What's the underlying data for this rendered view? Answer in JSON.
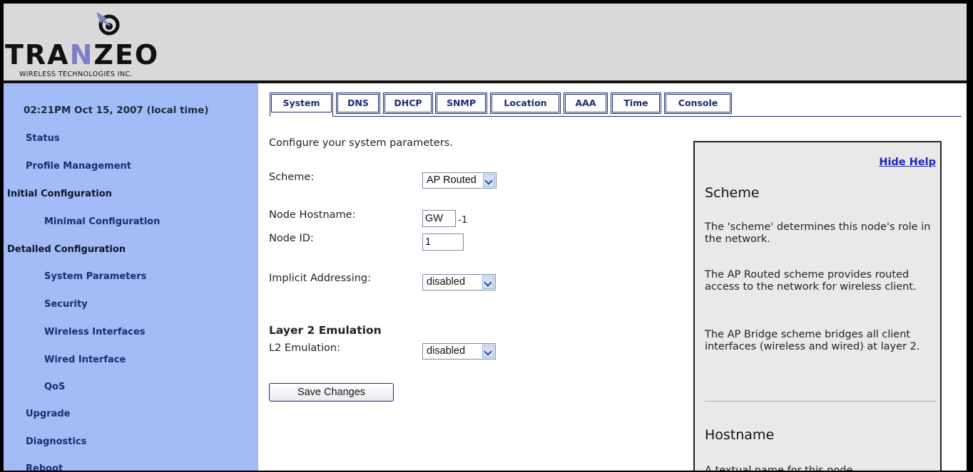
{
  "brand": {
    "name_parts": [
      "TRA",
      "N",
      "ZEO"
    ],
    "tagline": "WIRELESS TECHNOLOGIES INC.",
    "accent_color": "#7a7fc8"
  },
  "sidebar": {
    "clock": "02:21PM Oct 15, 2007 (local time)",
    "items": [
      {
        "label": "Status"
      },
      {
        "label": "Profile Management"
      },
      {
        "label": "Initial Configuration"
      },
      {
        "label": "Minimal Configuration"
      },
      {
        "label": "Detailed Configuration"
      },
      {
        "label": "System Parameters"
      },
      {
        "label": "Security"
      },
      {
        "label": "Wireless Interfaces"
      },
      {
        "label": "Wired Interface"
      },
      {
        "label": "QoS"
      },
      {
        "label": "Upgrade"
      },
      {
        "label": "Diagnostics"
      },
      {
        "label": "Reboot"
      }
    ]
  },
  "tabs": [
    {
      "label": "System",
      "active": true
    },
    {
      "label": "DNS"
    },
    {
      "label": "DHCP"
    },
    {
      "label": "SNMP"
    },
    {
      "label": "Location"
    },
    {
      "label": "AAA"
    },
    {
      "label": "Time"
    },
    {
      "label": "Console"
    }
  ],
  "form": {
    "intro": "Configure your system parameters.",
    "scheme_label": "Scheme:",
    "scheme_value": "AP Routed",
    "hostname_label": "Node Hostname:",
    "hostname_value": "GW",
    "hostname_suffix": "-1",
    "node_id_label": "Node ID:",
    "node_id_value": "1",
    "implicit_label": "Implicit Addressing:",
    "implicit_value": "disabled",
    "l2_heading": "Layer 2 Emulation",
    "l2_label": "L2 Emulation:",
    "l2_value": "disabled",
    "save_label": "Save Changes"
  },
  "help": {
    "hide_label": "Hide Help",
    "scheme_title": "Scheme",
    "scheme_p1": "The 'scheme' determines this node's role in the network.",
    "scheme_p2": "The AP Routed scheme provides routed access to the network for wireless client.",
    "scheme_p3": "The AP Bridge scheme bridges all client interfaces (wireless and wired) at layer 2.",
    "hostname_title": "Hostname",
    "hostname_p1": "A textual name for this node."
  },
  "colors": {
    "sidebar_bg": "#a3bcf7",
    "header_bg": "#d9d9d9",
    "nav_text": "#1e2a70",
    "link": "#1a2ab8"
  }
}
